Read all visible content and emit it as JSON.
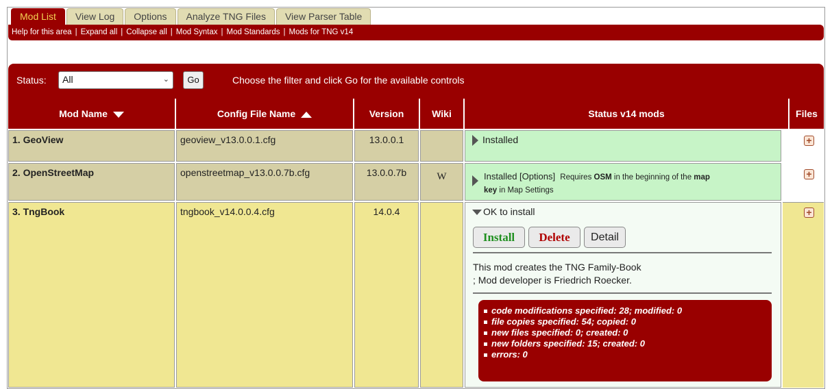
{
  "tabs": [
    "Mod List",
    "View Log",
    "Options",
    "Analyze TNG Files",
    "View Parser Table"
  ],
  "links": [
    "Help for this area",
    "Expand all",
    "Collapse all",
    "Mod Syntax",
    "Mod Standards",
    "Mods for TNG v14"
  ],
  "filter": {
    "label": "Status:",
    "selected": "All",
    "go": "Go",
    "hint": "Choose the filter and click Go for the available controls"
  },
  "columns": {
    "mod_name": "Mod Name",
    "config_file": "Config File Name",
    "version": "Version",
    "wiki": "Wiki",
    "status": "Status v14 mods",
    "files": "Files"
  },
  "mods": [
    {
      "name": "1. GeoView",
      "config": "geoview_v13.0.0.1.cfg",
      "version": "13.0.0.1",
      "wiki": "",
      "status": "Installed"
    },
    {
      "name": "2. OpenStreetMap",
      "config": "openstreetmap_v13.0.0.7b.cfg",
      "version": "13.0.0.7b",
      "wiki": "W",
      "status": "Installed [Options]",
      "note_a": "Requires ",
      "note_b": "OSM",
      "note_c": " in the beginning of the ",
      "note_d": "map",
      "note_e": "key",
      "note_f": " in Map Settings"
    },
    {
      "name": "3. TngBook",
      "config": "tngbook_v14.0.0.4.cfg",
      "version": "14.0.4",
      "wiki": "",
      "status": "OK to install"
    }
  ],
  "actions": {
    "install": "Install",
    "delete": "Delete",
    "detail": "Detail"
  },
  "description": [
    "This mod creates the TNG Family-Book",
    "; Mod developer is Friedrich Roecker."
  ],
  "summary": [
    "code modifications specified: 28; modified: 0",
    "file copies specified: 54; copied: 0",
    "new files specified: 0; created: 0",
    "new folders specified: 15; created: 0",
    "errors: 0"
  ],
  "colors": {
    "accent": "#990000",
    "tab_text": "#f3d252",
    "installed": "#c7f4c7",
    "install_green": "#1f8f1f",
    "delete_red": "#b00000"
  }
}
